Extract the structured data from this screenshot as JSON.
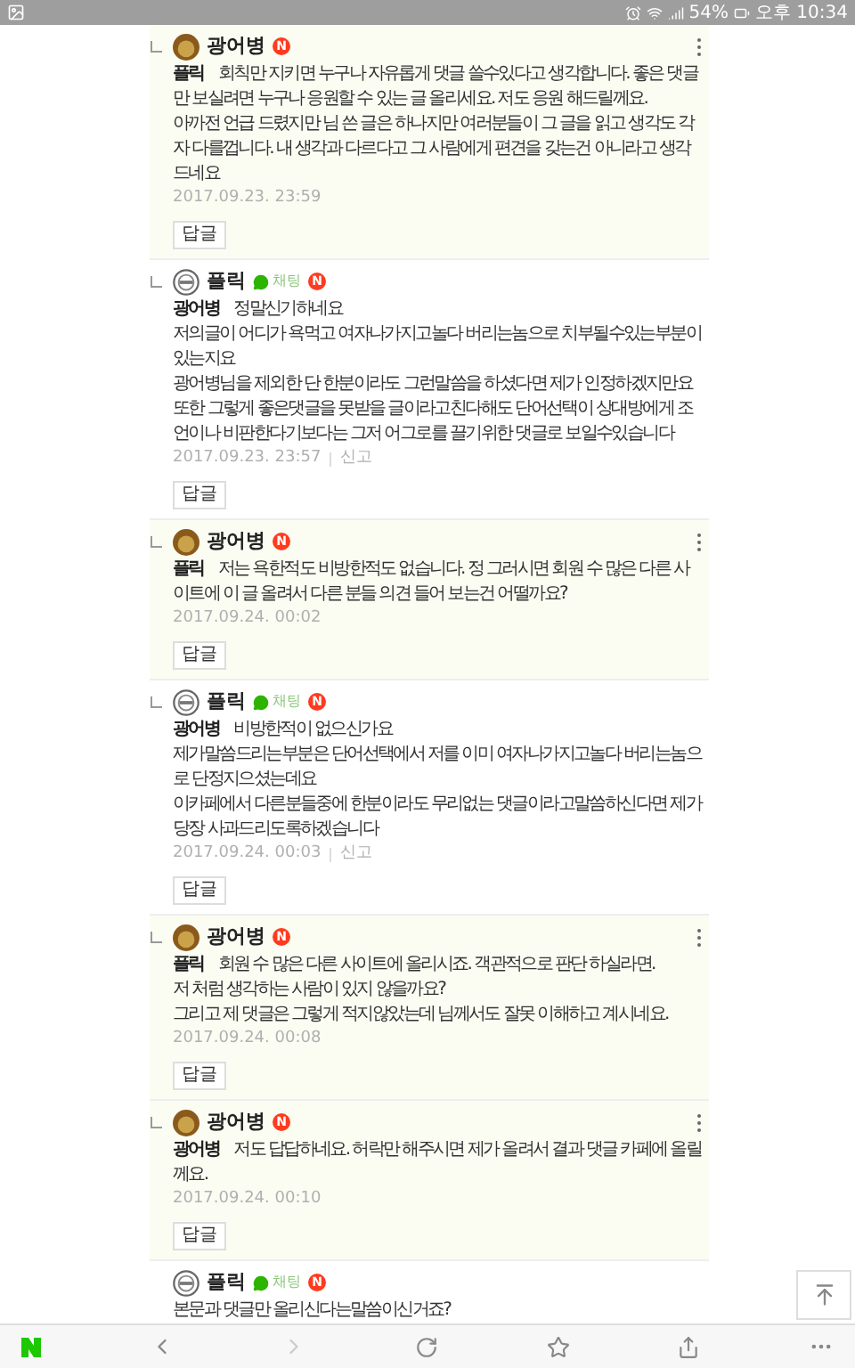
{
  "status_bar": {
    "battery": "54%",
    "time": "오후 10:34"
  },
  "comments": [
    {
      "reply": true,
      "highlighted": true,
      "kind": "photo",
      "author": "광어병",
      "new_badge": "N",
      "menu": true,
      "mention": "플릭",
      "text": "회칙만 지키면 누구나 자유롭게 댓글 쓸수있다고 생각합니다. 좋은 댓글만 보실려면 누구나 응원할 수 있는 글 올리세요. 저도 응원 해드릴께요.\n아까전 언급 드렸지만 님 쓴 글은 하나지만 여러분들이 그 글을 읽고 생각도 각자 다를껍니다. 내 생각과 다르다고 그 사람에게 편견을 갖는건 아니라고 생각드네요",
      "date": "2017.09.23. 23:59",
      "reply_button": "답글"
    },
    {
      "reply": true,
      "highlighted": false,
      "kind": "logo",
      "author": "플릭",
      "chat": "채팅",
      "new_badge": "N",
      "menu": false,
      "mention": "광어병",
      "text": "정말신기하네요\n저의글이 어디가 욕먹고 여자나가지고놀다 버리는놈으로 치부될수있는부분이 있는지요\n광어병님을 제외한 단 한분이라도 그런말씀을 하셨다면 제가 인정하겠지만요\n또한 그렇게 좋은댓글을 못받을 글이라고친다해도 단어선택이 상대방에게 조언이나 비판한다기보다는 그저 어그로를 끌기위한 댓글로 보일수있습니다",
      "date": "2017.09.23. 23:57",
      "report": "신고",
      "reply_button": "답글"
    },
    {
      "reply": true,
      "highlighted": true,
      "kind": "photo",
      "author": "광어병",
      "new_badge": "N",
      "menu": true,
      "mention": "플릭",
      "text": "저는 욕한적도 비방한적도 없습니다. 정 그러시면 회원 수 많은 다른 사이트에 이 글 올려서 다른 분들 의견 들어 보는건 어떨까요?",
      "date": "2017.09.24. 00:02",
      "reply_button": "답글"
    },
    {
      "reply": true,
      "highlighted": false,
      "kind": "logo",
      "author": "플릭",
      "chat": "채팅",
      "new_badge": "N",
      "menu": false,
      "mention": "광어병",
      "text": "비방한적이 없으신가요\n제가말씀드리는부분은 단어선택에서 저를 이미 여자나가지고놀다 버리는놈으로 단정지으셨는데요\n이카페에서 다른분들중에 한분이라도 무리없는 댓글이라고말씀하신다면 제가 당장 사과드리도록하겠습니다",
      "date": "2017.09.24. 00:03",
      "report": "신고",
      "reply_button": "답글"
    },
    {
      "reply": true,
      "highlighted": true,
      "kind": "photo",
      "author": "광어병",
      "new_badge": "N",
      "menu": true,
      "mention": "플릭",
      "text": "회원 수 많은 다른 사이트에 올리시죠. 객관적으로 판단 하실라면.\n저 처럼 생각하는 사람이 있지 않을까요?\n그리고 제 댓글은 그렇게 적지않았는데 님께서도 잘못 이해하고 계시네요.",
      "date": "2017.09.24. 00:08",
      "reply_button": "답글"
    },
    {
      "reply": true,
      "highlighted": true,
      "kind": "photo",
      "author": "광어병",
      "new_badge": "N",
      "menu": true,
      "mention": "광어병",
      "text": "저도 답답하네요. 허락만 해주시면 제가 올려서 결과 댓글 카페에 올릴께요.",
      "date": "2017.09.24. 00:10",
      "reply_button": "답글"
    },
    {
      "reply": false,
      "highlighted": false,
      "kind": "logo",
      "author": "플릭",
      "chat": "채팅",
      "new_badge": "N",
      "menu": false,
      "text": "본문과 댓글만 올리신다는말씀이신거죠?"
    }
  ]
}
